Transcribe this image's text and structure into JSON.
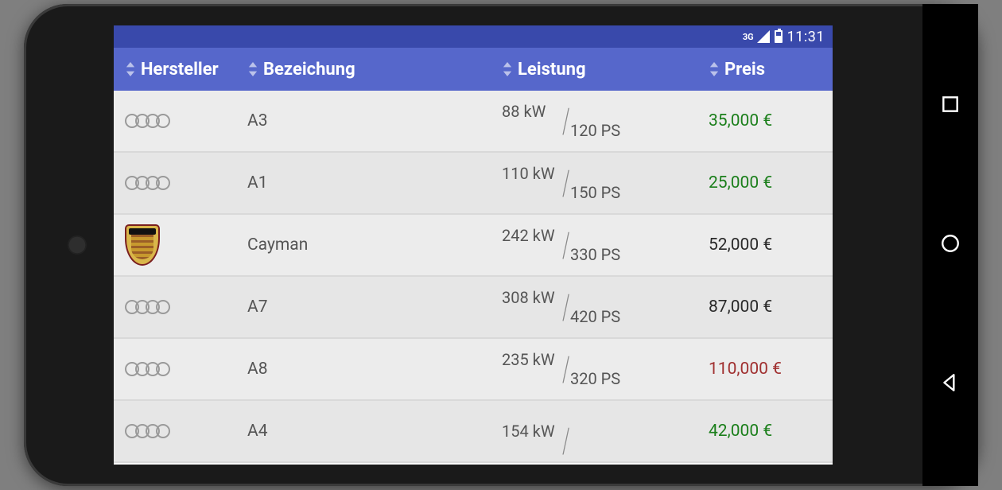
{
  "status": {
    "network": "3G",
    "clock": "11:31"
  },
  "headers": {
    "maker": "Hersteller",
    "name": "Bezeichung",
    "power": "Leistung",
    "price": "Preis"
  },
  "rows": [
    {
      "maker": "audi",
      "name": "A3",
      "kw": "88 kW",
      "ps": "120 PS",
      "price": "35,000 €",
      "priceClass": "price-green"
    },
    {
      "maker": "audi",
      "name": "A1",
      "kw": "110 kW",
      "ps": "150 PS",
      "price": "25,000 €",
      "priceClass": "price-green"
    },
    {
      "maker": "porsche",
      "name": "Cayman",
      "kw": "242 kW",
      "ps": "330 PS",
      "price": "52,000 €",
      "priceClass": "price-black"
    },
    {
      "maker": "audi",
      "name": "A7",
      "kw": "308 kW",
      "ps": "420 PS",
      "price": "87,000 €",
      "priceClass": "price-black"
    },
    {
      "maker": "audi",
      "name": "A8",
      "kw": "235 kW",
      "ps": "320 PS",
      "price": "110,000 €",
      "priceClass": "price-red"
    },
    {
      "maker": "audi",
      "name": "A4",
      "kw": "154 kW",
      "ps": "",
      "price": "42,000 €",
      "priceClass": "price-green"
    }
  ]
}
